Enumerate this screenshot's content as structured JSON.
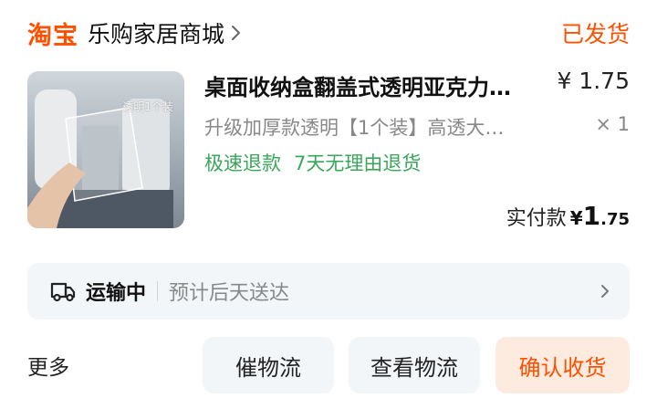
{
  "header": {
    "brand": "淘宝",
    "shop_name": "乐购家居商城",
    "order_status": "已发货"
  },
  "item": {
    "image_label": "透明1个装",
    "title": "桌面收纳盒翻盖式透明亚克力…",
    "price": "¥ 1.75",
    "sku": "升级加厚款透明【1个装】高透大…",
    "quantity": "× 1",
    "tags": [
      "极速退款",
      "7天无理由退货"
    ]
  },
  "payment": {
    "label": "实付款",
    "currency": "¥",
    "integer": "1",
    "decimal": ".75"
  },
  "logistics": {
    "status": "运输中",
    "detail": "预计后天送达"
  },
  "actions": {
    "more": "更多",
    "remind": "催物流",
    "track": "查看物流",
    "confirm": "确认收货"
  },
  "colors": {
    "accent": "#ff5000",
    "tag_green": "#3aa65a",
    "panel_bg": "#f3f6f9"
  }
}
